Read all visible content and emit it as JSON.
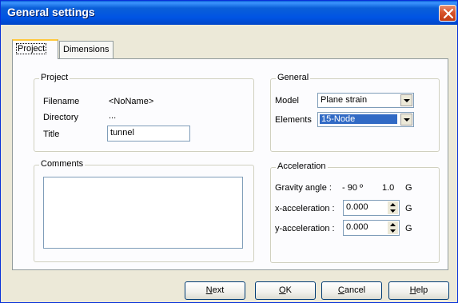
{
  "window": {
    "title": "General settings"
  },
  "tabs": [
    {
      "label": "Project"
    },
    {
      "label": "Dimensions"
    }
  ],
  "project_group": {
    "legend": "Project",
    "filename_label": "Filename",
    "filename_value": "<NoName>",
    "directory_label": "Directory",
    "directory_value": "...",
    "title_label": "Title",
    "title_value": "tunnel"
  },
  "comments_group": {
    "legend": "Comments",
    "value": ""
  },
  "general_group": {
    "legend": "General",
    "model_label": "Model",
    "model_value": "Plane strain",
    "elements_label": "Elements",
    "elements_value": "15-Node"
  },
  "acceleration_group": {
    "legend": "Acceleration",
    "gravity_label": "Gravity angle :",
    "gravity_angle": "- 90 º",
    "gravity_value": "1.0",
    "gravity_unit": "G",
    "x_label": "x-acceleration :",
    "x_value": "0.000",
    "x_unit": "G",
    "y_label": "y-acceleration :",
    "y_value": "0.000",
    "y_unit": "G"
  },
  "buttons": {
    "next": {
      "label_first": "N",
      "label_rest": "ext"
    },
    "ok": {
      "label_first": "O",
      "label_rest": "K"
    },
    "cancel": {
      "label_first": "C",
      "label_rest": "ancel"
    },
    "help": {
      "label_first": "H",
      "label_rest": "elp"
    }
  },
  "colors": {
    "titlebar": "#0054e3",
    "selection": "#316ac5",
    "face": "#ece9d8"
  },
  "icons": {
    "close": "close-icon",
    "dropdown": "chevron-down-icon",
    "spin": "spin-arrows-icon"
  }
}
